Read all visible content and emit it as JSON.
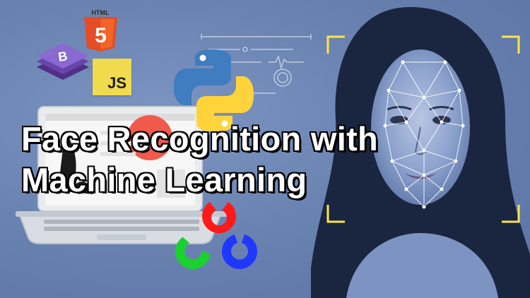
{
  "title": {
    "line1": "Face Recognition with",
    "line2": "Machine Learning"
  },
  "logos": {
    "html5": "5",
    "js": "JS"
  },
  "icons": {
    "html5": "html5-icon",
    "bootstrap": "bootstrap-icon",
    "javascript": "javascript-icon",
    "python": "python-icon",
    "opencv": "opencv-icon",
    "laptop": "laptop-icon",
    "face_mesh": "face-mesh-icon",
    "focus_corners": "focus-frame-icon",
    "hud": "hud-graphic-icon"
  },
  "colors": {
    "background": "#6b84b2",
    "html5_orange": "#e44d26",
    "js_yellow": "#f0db4f",
    "bootstrap_purple": "#7952b3",
    "python_blue": "#3775a9",
    "python_yellow": "#ffd43b",
    "opencv_red": "#ff1a1a",
    "opencv_green": "#17d12b",
    "opencv_blue": "#1a3cff",
    "frame_yellow": "#ffe44d"
  }
}
